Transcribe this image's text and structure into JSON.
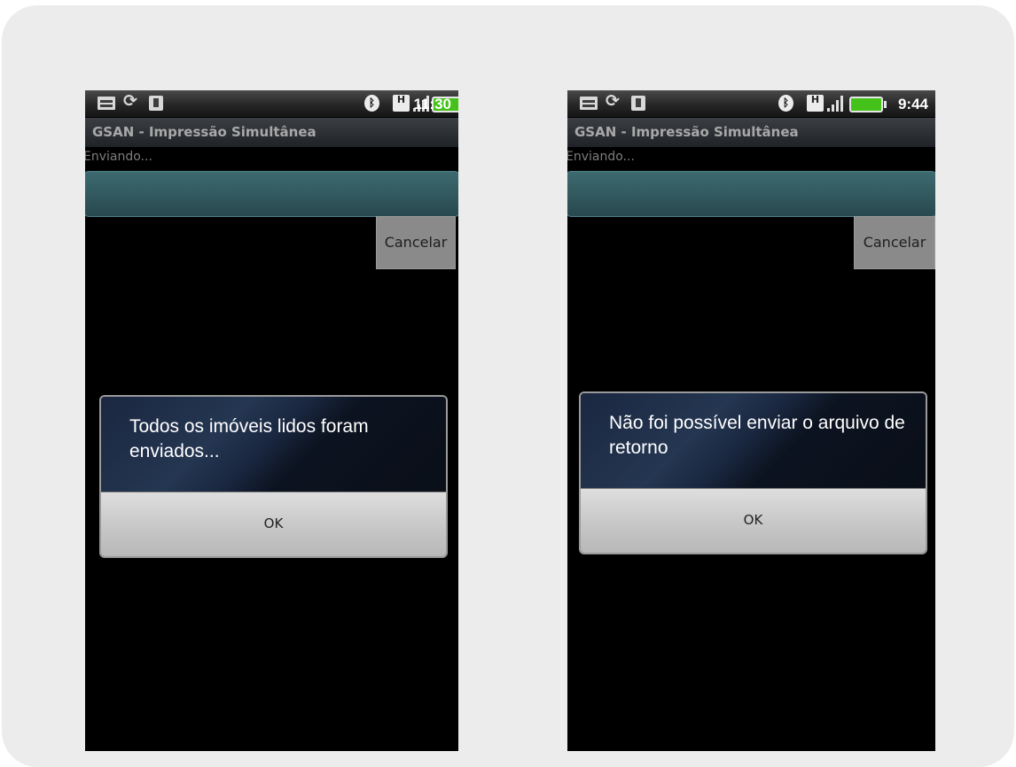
{
  "screens": [
    {
      "status": {
        "time": "11:30",
        "bluetooth_icon": "bluetooth-icon",
        "h_icon_label": "H",
        "battery_color": "#44c21a"
      },
      "app_title": "GSAN - Impressão Simultânea",
      "status_text": "Enviando...",
      "cancel_label": "Cancelar",
      "dialog": {
        "message": "Todos os imóveis lidos foram enviados...",
        "ok_label": "OK"
      }
    },
    {
      "status": {
        "time": "9:44",
        "bluetooth_icon": "bluetooth-icon",
        "h_icon_label": "H",
        "battery_color": "#44c21a"
      },
      "app_title": "GSAN - Impressão Simultânea",
      "status_text": "Enviando...",
      "cancel_label": "Cancelar",
      "dialog": {
        "message": "Não foi possível enviar o arquivo de retorno",
        "ok_label": "OK"
      }
    }
  ],
  "colors": {
    "frame_background": "#ececec",
    "progress_teal": "#2f5a60",
    "dialog_dark": "#1a2537"
  }
}
